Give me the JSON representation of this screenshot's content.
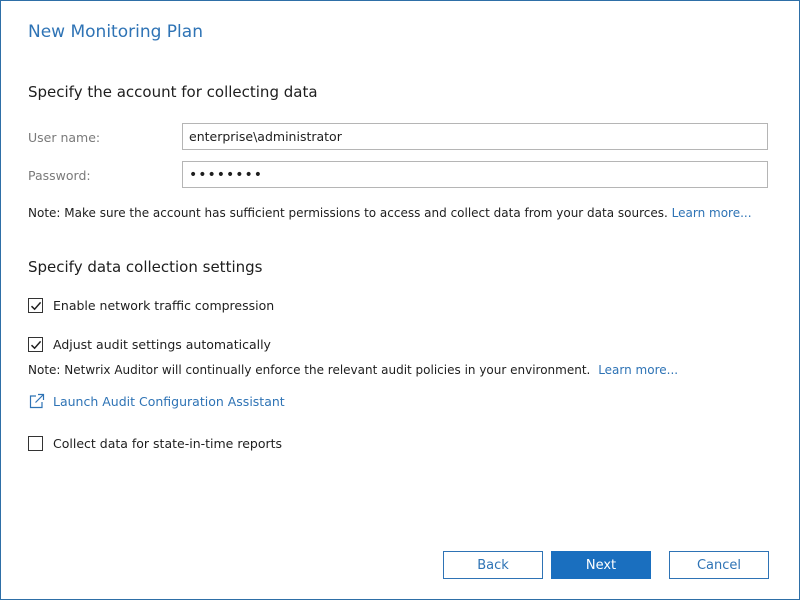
{
  "window": {
    "title": "New Monitoring Plan"
  },
  "account_section": {
    "heading": "Specify the account for collecting data",
    "username_label": "User name:",
    "username_value": "enterprise\\administrator",
    "password_label": "Password:",
    "password_value": "••••••••",
    "note_text": "Note: Make sure the account has sufficient permissions to access and collect data from your data sources.",
    "note_link": "Learn more..."
  },
  "collection_section": {
    "heading": "Specify data collection settings",
    "compression": {
      "label": "Enable network traffic compression",
      "checked": true
    },
    "audit_settings": {
      "label": "Adjust audit settings automatically",
      "checked": true
    },
    "audit_note_text": "Note: Netwrix Auditor will continually enforce the relevant audit policies in your environment.",
    "audit_note_link": "Learn more...",
    "launch_assistant": "Launch Audit Configuration Assistant",
    "state_in_time": {
      "label": "Collect data for state-in-time reports",
      "checked": false
    }
  },
  "footer": {
    "back_label": "Back",
    "next_label": "Next",
    "cancel_label": "Cancel"
  },
  "colors": {
    "accent": "#2e73b5",
    "primary_button": "#1a6fbf",
    "window_border": "#2e6fa7"
  },
  "icons": {
    "checkbox_checked": "checkmark-icon",
    "launch": "external-link-icon"
  }
}
